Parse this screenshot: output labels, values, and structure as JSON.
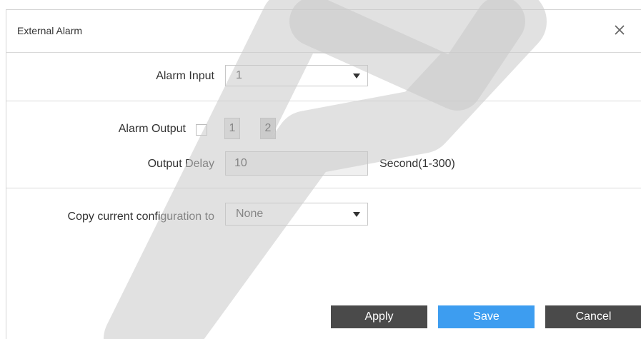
{
  "dialog": {
    "title": "External Alarm",
    "close_symbol": "✕"
  },
  "alarm_input": {
    "label": "Alarm Input",
    "value": "1"
  },
  "alarm_output": {
    "label": "Alarm Output",
    "checked": false,
    "channels": [
      "1",
      "2"
    ]
  },
  "output_delay": {
    "label": "Output Delay",
    "value": "10",
    "unit": "Second(1-300)"
  },
  "copy_config": {
    "label": "Copy current configuration to",
    "value": "None"
  },
  "buttons": {
    "apply": "Apply",
    "save": "Save",
    "cancel": "Cancel"
  },
  "colors": {
    "primary": "#3d9df0",
    "dark_button": "#4a4a4a",
    "watermark": "#c8c8c8"
  }
}
